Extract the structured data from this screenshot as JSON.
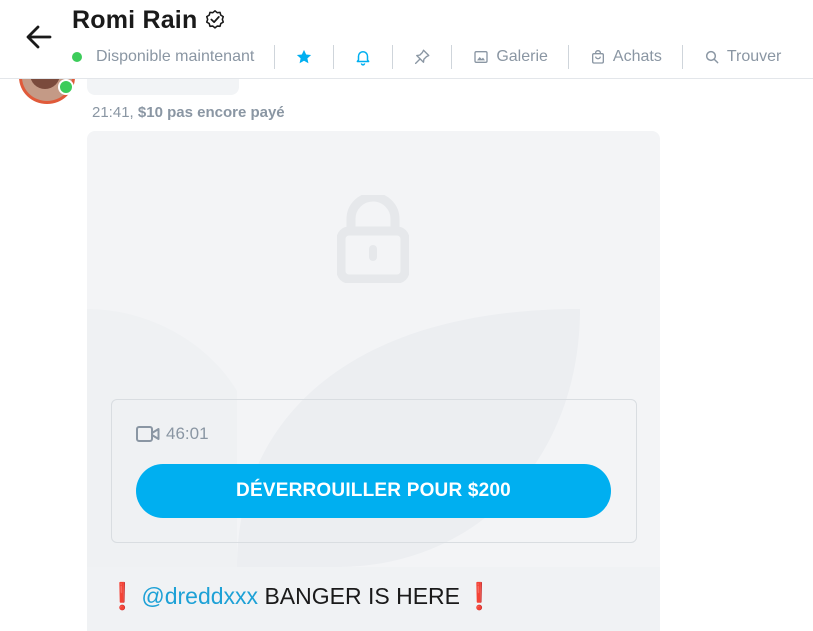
{
  "header": {
    "name": "Romi Rain",
    "status": "Disponible maintenant",
    "toolbar": {
      "gallery_label": "Galerie",
      "purchases_label": "Achats",
      "find_label": "Trouver"
    },
    "colors": {
      "accent": "#00aff0",
      "online": "#3ccc5a"
    }
  },
  "message": {
    "time": "21:41,",
    "price_status": "$10 pas encore payé",
    "media": {
      "duration": "46:01",
      "unlock_label": "DÉVERROUILLER POUR $200"
    },
    "caption": {
      "excl_left": "❗",
      "mention": "@dreddxxx",
      "text": " BANGER IS HERE",
      "excl_right": "❗"
    }
  },
  "icons": [
    "back-arrow-icon",
    "verified-icon",
    "star-icon",
    "bell-icon",
    "pin-icon",
    "gallery-icon",
    "bag-icon",
    "search-icon",
    "lock-icon",
    "video-camera-icon"
  ]
}
